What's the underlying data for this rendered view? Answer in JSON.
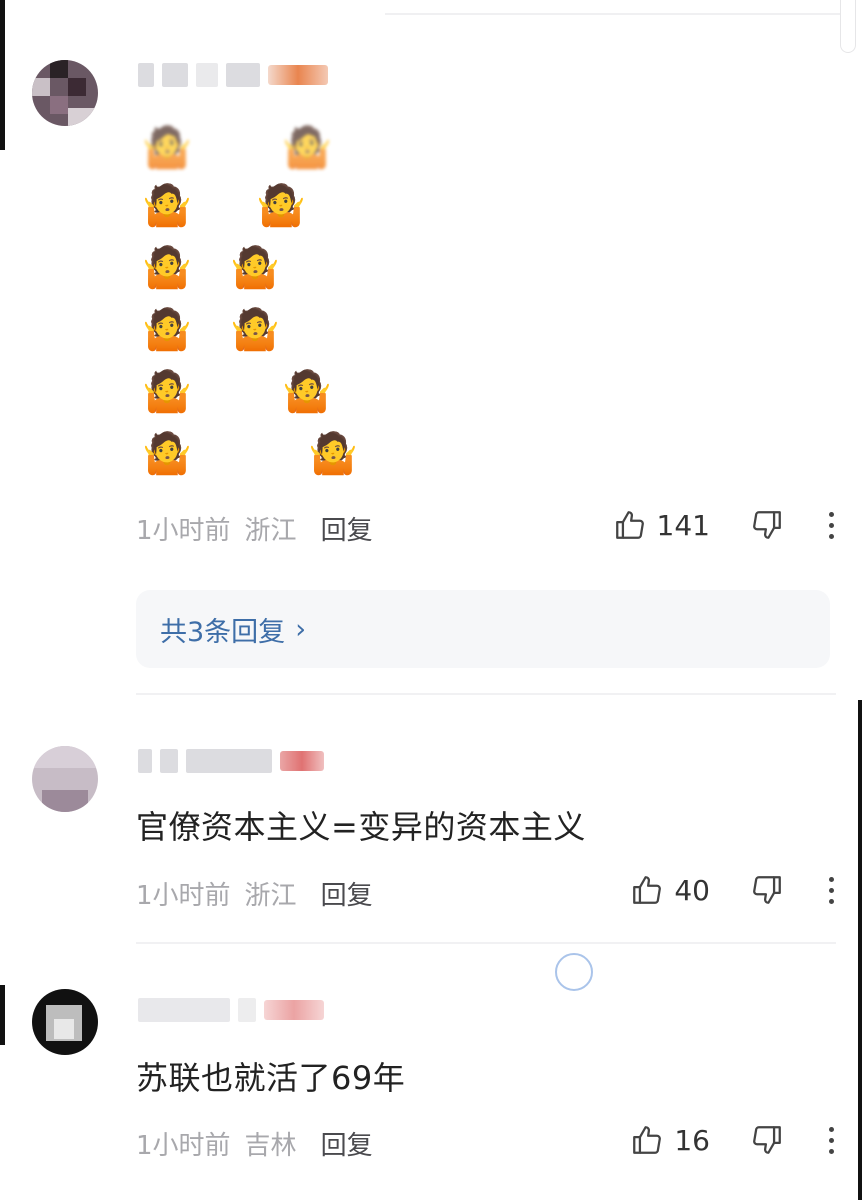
{
  "comments": [
    {
      "body": "",
      "emoji": "🤷",
      "time": "1小时前",
      "region": "浙江",
      "reply_label": "回复",
      "likes": "141",
      "replies_link": "共3条回复"
    },
    {
      "body": "官僚资本主义=变异的资本主义",
      "time": "1小时前",
      "region": "浙江",
      "reply_label": "回复",
      "likes": "40"
    },
    {
      "body": "苏联也就活了69年",
      "time": "1小时前",
      "region": "吉林",
      "reply_label": "回复",
      "likes": "16"
    }
  ],
  "icons": {
    "like": "thumbs-up-icon",
    "dislike": "thumbs-down-icon",
    "more": "more-vertical-icon",
    "chevron": "chevron-right-icon"
  },
  "colors": {
    "link": "#3e6ea8",
    "meta": "#a8a8ac",
    "text": "#222222",
    "reply_box": "#f6f7f9"
  }
}
